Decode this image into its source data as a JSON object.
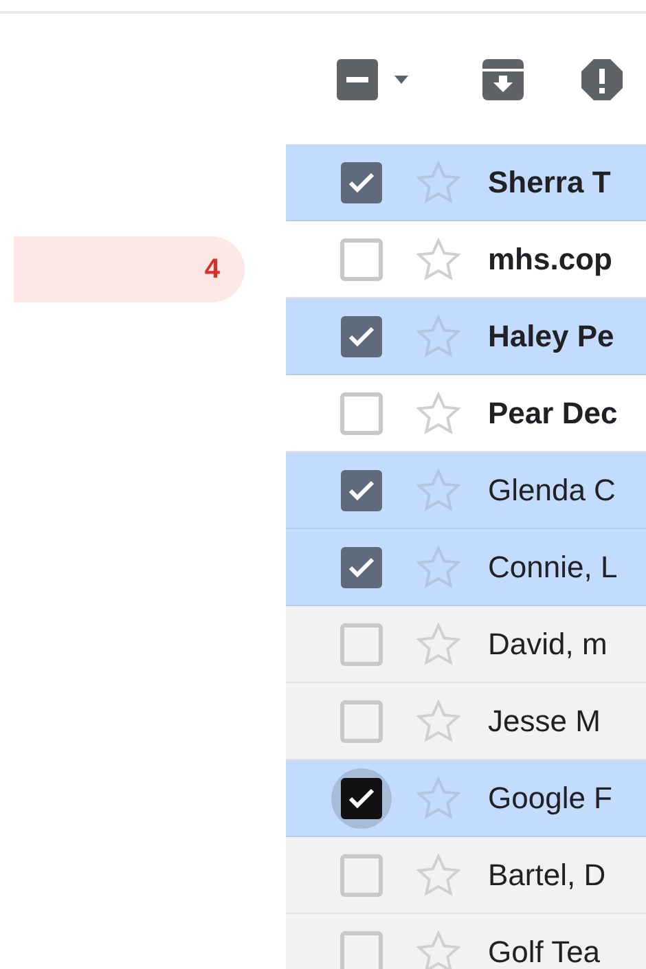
{
  "sidebar": {
    "items": [
      {
        "count": "4",
        "selected": true
      }
    ]
  },
  "toolbar": {
    "select_all": {
      "indeterminate": true
    }
  },
  "messages": [
    {
      "sender": "Sherra T",
      "unread": true,
      "selected": true,
      "starred": false,
      "focused": false
    },
    {
      "sender": "mhs.cop",
      "unread": true,
      "selected": false,
      "starred": false,
      "focused": false
    },
    {
      "sender": "Haley Pe",
      "unread": true,
      "selected": true,
      "starred": false,
      "focused": false
    },
    {
      "sender": "Pear Dec",
      "unread": true,
      "selected": false,
      "starred": false,
      "focused": false
    },
    {
      "sender": "Glenda C",
      "unread": false,
      "selected": true,
      "starred": false,
      "focused": false
    },
    {
      "sender": "Connie, L",
      "unread": false,
      "selected": true,
      "starred": false,
      "focused": false
    },
    {
      "sender": "David, m",
      "unread": false,
      "selected": false,
      "starred": false,
      "focused": false
    },
    {
      "sender": "Jesse M",
      "unread": false,
      "selected": false,
      "starred": false,
      "focused": false
    },
    {
      "sender": "Google F",
      "unread": false,
      "selected": true,
      "starred": false,
      "focused": true
    },
    {
      "sender": "Bartel, D",
      "unread": false,
      "selected": false,
      "starred": false,
      "focused": false
    },
    {
      "sender": "Golf Tea",
      "unread": false,
      "selected": false,
      "starred": false,
      "focused": false
    }
  ]
}
